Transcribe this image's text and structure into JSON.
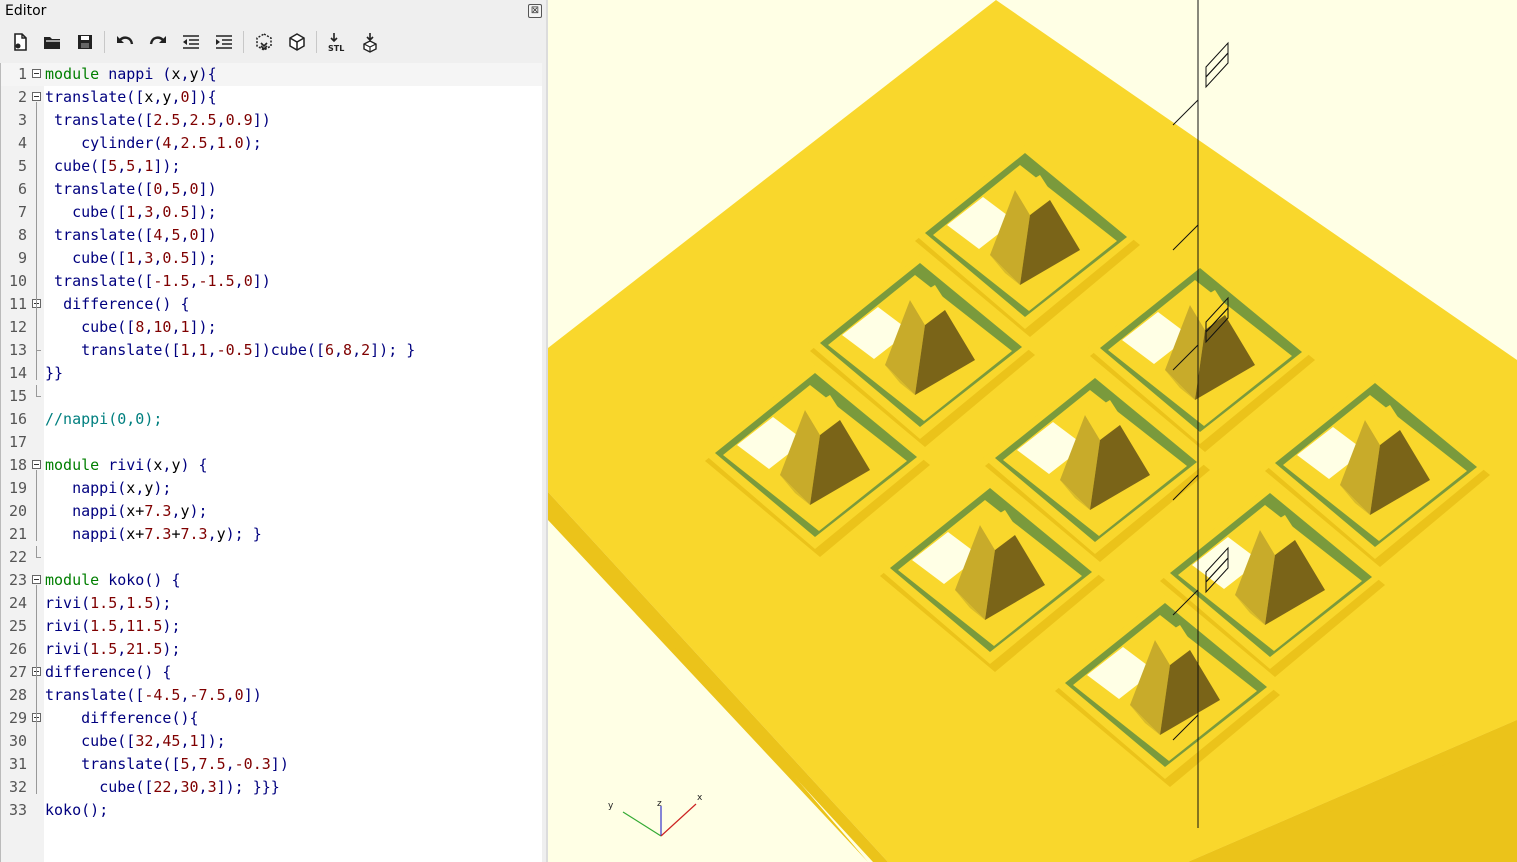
{
  "editor": {
    "title": "Editor",
    "close_glyph": "⊠",
    "toolbar": [
      {
        "name": "new-file-icon"
      },
      {
        "name": "open-folder-icon"
      },
      {
        "name": "save-icon"
      },
      {
        "name": "undo-icon"
      },
      {
        "name": "redo-icon"
      },
      {
        "name": "unindent-icon"
      },
      {
        "name": "indent-icon"
      },
      {
        "name": "preview-icon"
      },
      {
        "name": "render-icon"
      },
      {
        "name": "export-stl-icon",
        "label": "STL"
      },
      {
        "name": "send-to-print-icon"
      }
    ],
    "lines": [
      {
        "n": "1",
        "text": "module nappi (x,y){"
      },
      {
        "n": "2",
        "text": "translate([x,y,0]){"
      },
      {
        "n": "3",
        "text": " translate([2.5,2.5,0.9])"
      },
      {
        "n": "4",
        "text": "    cylinder(4,2.5,1.0);"
      },
      {
        "n": "5",
        "text": " cube([5,5,1]);"
      },
      {
        "n": "6",
        "text": " translate([0,5,0])"
      },
      {
        "n": "7",
        "text": "   cube([1,3,0.5]);"
      },
      {
        "n": "8",
        "text": " translate([4,5,0])"
      },
      {
        "n": "9",
        "text": "   cube([1,3,0.5]);"
      },
      {
        "n": "10",
        "text": " translate([-1.5,-1.5,0])"
      },
      {
        "n": "11",
        "text": "  difference() {"
      },
      {
        "n": "12",
        "text": "    cube([8,10,1]);"
      },
      {
        "n": "13",
        "text": "    translate([1,1,-0.5])cube([6,8,2]); }"
      },
      {
        "n": "14",
        "text": "}}"
      },
      {
        "n": "15",
        "text": ""
      },
      {
        "n": "16",
        "text": "//nappi(0,0);"
      },
      {
        "n": "17",
        "text": ""
      },
      {
        "n": "18",
        "text": "module rivi(x,y) {"
      },
      {
        "n": "19",
        "text": "   nappi(x,y);"
      },
      {
        "n": "20",
        "text": "   nappi(x+7.3,y);"
      },
      {
        "n": "21",
        "text": "   nappi(x+7.3+7.3,y); }"
      },
      {
        "n": "22",
        "text": ""
      },
      {
        "n": "23",
        "text": "module koko() {"
      },
      {
        "n": "24",
        "text": "rivi(1.5,1.5);"
      },
      {
        "n": "25",
        "text": "rivi(1.5,11.5);"
      },
      {
        "n": "26",
        "text": "rivi(1.5,21.5);"
      },
      {
        "n": "27",
        "text": "difference() {"
      },
      {
        "n": "28",
        "text": "translate([-4.5,-7.5,0])"
      },
      {
        "n": "29",
        "text": "    difference(){"
      },
      {
        "n": "30",
        "text": "    cube([32,45,1]);"
      },
      {
        "n": "31",
        "text": "    translate([5,7.5,-0.3])"
      },
      {
        "n": "32",
        "text": "      cube([22,30,3]); }}}"
      },
      {
        "n": "33",
        "text": "koko();"
      }
    ]
  },
  "viewport": {
    "axes": {
      "x": "x",
      "y": "y",
      "z": "z"
    },
    "colors": {
      "background": "#ffffe5",
      "plate_top": "#f9d72c",
      "plate_side": "#ebc31a",
      "pit": "#7a9a3c",
      "cone_light": "#c8ab2a",
      "cone_dark": "#7a6418",
      "white_face": "#ffffe5"
    }
  }
}
